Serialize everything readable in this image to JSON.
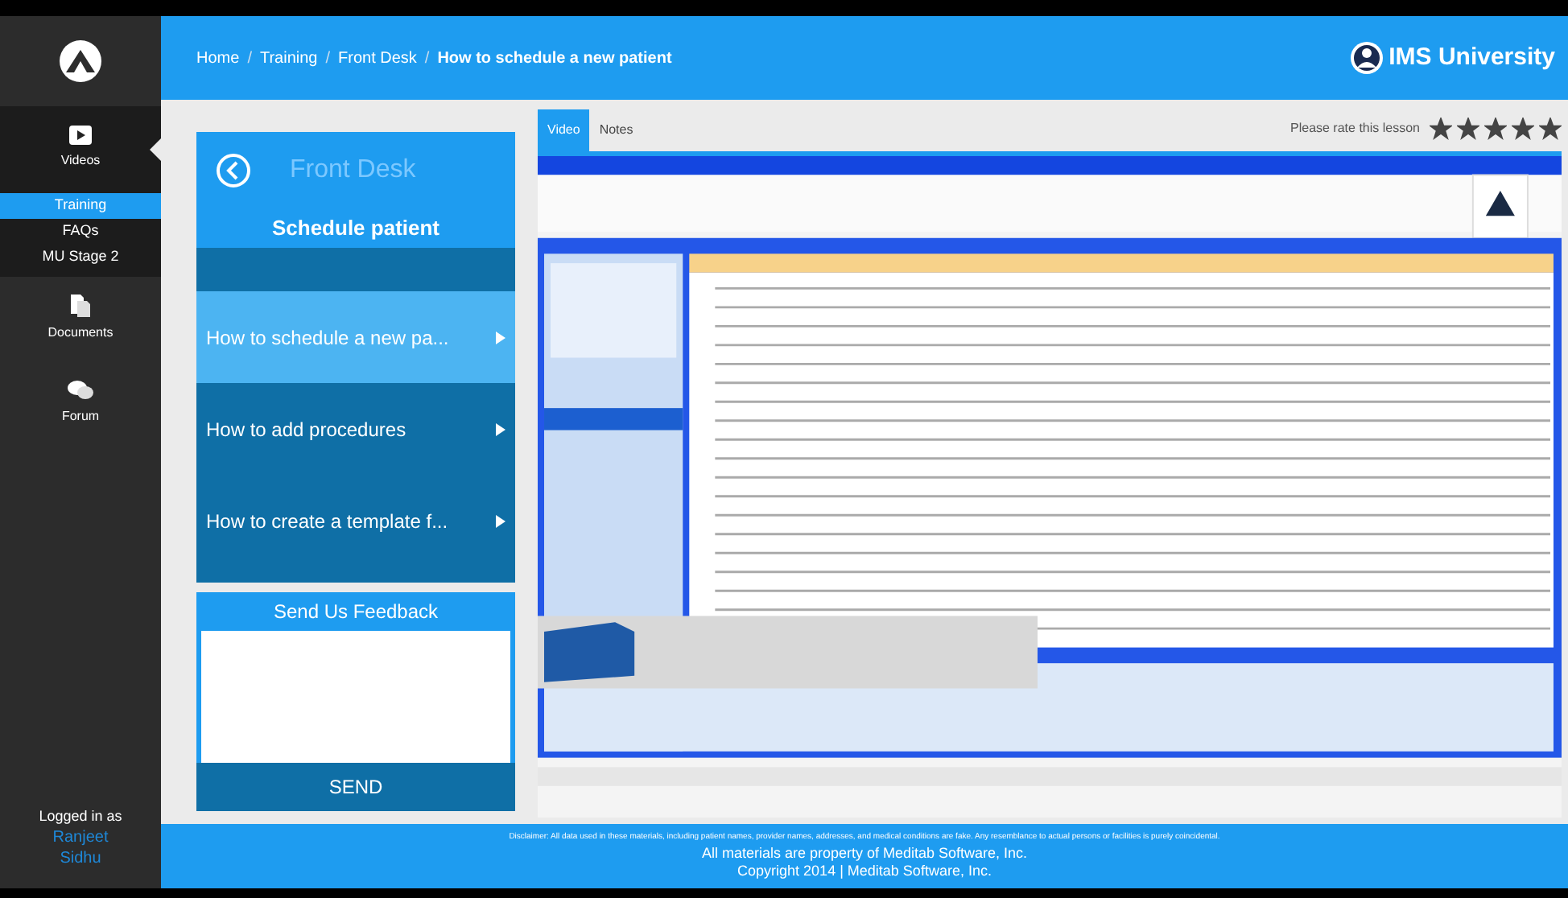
{
  "sidebar": {
    "items": [
      {
        "kind": "video",
        "label": "Videos",
        "selected": true,
        "children": [
          {
            "label": "Training",
            "selected": true
          },
          {
            "label": "FAQs",
            "selected": false
          },
          {
            "label": "MU Stage 2",
            "selected": false
          }
        ]
      },
      {
        "kind": "documents",
        "label": "Documents",
        "selected": false
      },
      {
        "kind": "forum",
        "label": "Forum",
        "selected": false
      }
    ],
    "login": {
      "label": "Logged in as",
      "user": "Ranjeet Sidhu"
    }
  },
  "header": {
    "breadcrumb": [
      "Home",
      "Training",
      "Front Desk"
    ],
    "separator": "/",
    "current": "How to schedule a new patient",
    "brand": "IMS University"
  },
  "lesson_panel": {
    "title": "Front Desk",
    "subtitle": "Schedule patient",
    "lessons": [
      {
        "label": "How to schedule a new pa...",
        "selected": true
      },
      {
        "label": "How to add procedures",
        "selected": false
      },
      {
        "label": "How to create a template f...",
        "selected": false
      }
    ]
  },
  "feedback": {
    "title": "Send Us Feedback",
    "button": "SEND"
  },
  "tabs": [
    {
      "label": "Video",
      "selected": true
    },
    {
      "label": "Notes",
      "selected": false
    }
  ],
  "rating": {
    "label": "Please rate this lesson",
    "stars": 5
  },
  "footer": {
    "disclaimer": "Disclaimer: All data used in these materials, including patient names, provider names, addresses, and medical conditions are fake. Any resemblance to actual persons or facilities is purely coincidental.",
    "lines": [
      "All materials are property of Meditab Software, Inc.",
      "Copyright 2014 | Meditab Software, Inc."
    ]
  }
}
